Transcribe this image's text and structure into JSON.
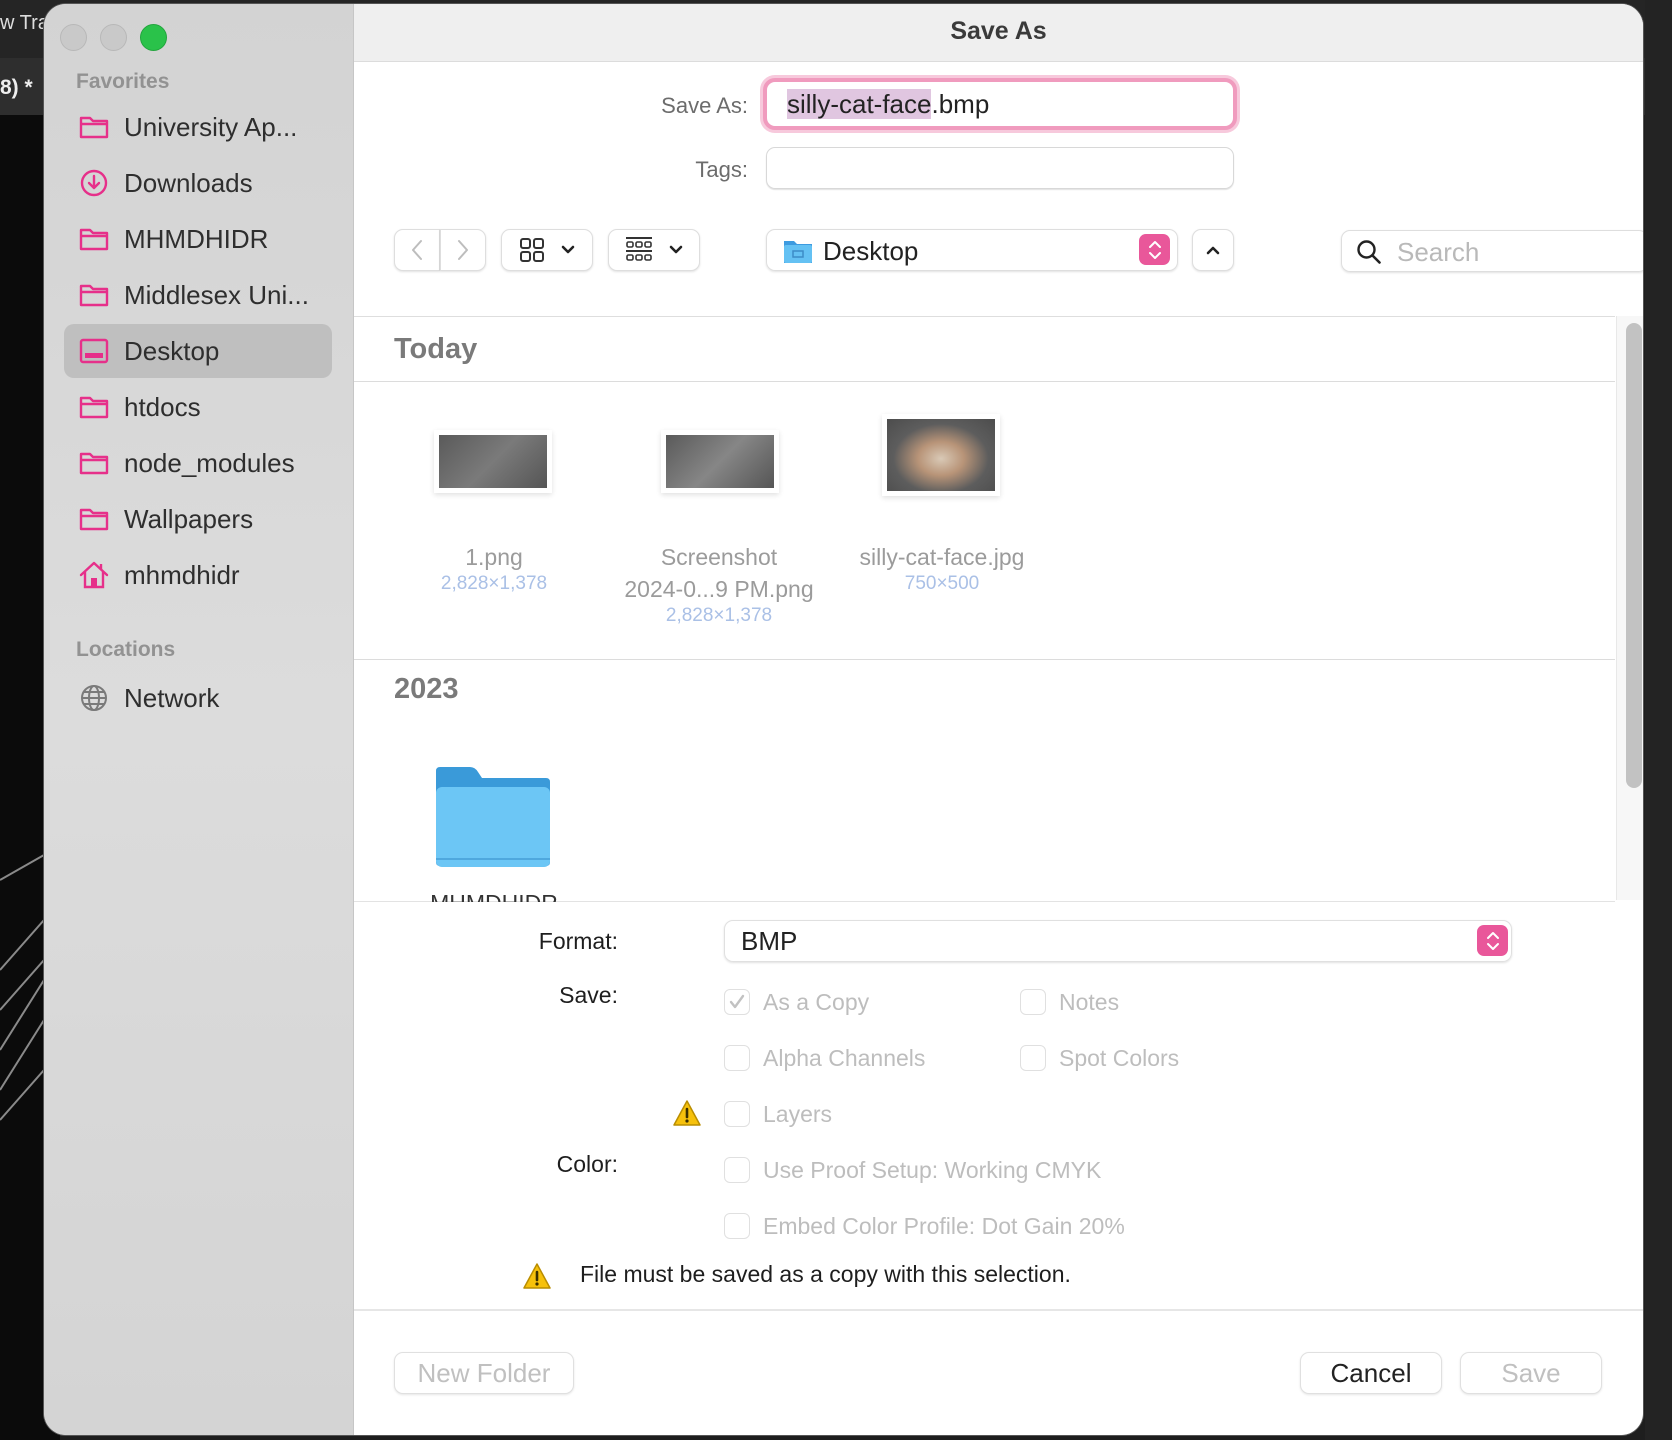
{
  "background": {
    "app_title_fragment": "w Tra",
    "doc_tab_fragment": "8) *"
  },
  "window": {
    "title": "Save As",
    "traffic_lights": [
      "close",
      "minimize",
      "zoom"
    ]
  },
  "sidebar": {
    "favorites_heading": "Favorites",
    "favorites": [
      {
        "label": "University Ap...",
        "icon": "folder-icon",
        "selected": false
      },
      {
        "label": "Downloads",
        "icon": "download-icon",
        "selected": false
      },
      {
        "label": "MHMDHIDR",
        "icon": "folder-icon",
        "selected": false
      },
      {
        "label": "Middlesex Uni...",
        "icon": "folder-icon",
        "selected": false
      },
      {
        "label": "Desktop",
        "icon": "desktop-icon",
        "selected": true
      },
      {
        "label": "htdocs",
        "icon": "folder-icon",
        "selected": false
      },
      {
        "label": "node_modules",
        "icon": "folder-icon",
        "selected": false
      },
      {
        "label": "Wallpapers",
        "icon": "folder-icon",
        "selected": false
      },
      {
        "label": "mhmdhidr",
        "icon": "home-icon",
        "selected": false
      }
    ],
    "locations_heading": "Locations",
    "locations": [
      {
        "label": "Network",
        "icon": "globe-icon"
      }
    ]
  },
  "form": {
    "save_as_label": "Save As:",
    "save_as_value_selected": "silly-cat-face",
    "save_as_value_ext": ".bmp",
    "tags_label": "Tags:",
    "tags_value": ""
  },
  "toolbar": {
    "back": "back-icon",
    "forward": "forward-icon",
    "icon_view": "grid-view-icon",
    "group_view": "gallery-group-icon",
    "location": "Desktop",
    "search_placeholder": "Search"
  },
  "filelist": {
    "sections": [
      {
        "title": "Today",
        "files": [
          {
            "name": "1.png",
            "dimensions": "2,828×1,378"
          },
          {
            "name": "Screenshot 2024-0...9 PM.png",
            "name_line1": "Screenshot",
            "name_line2": "2024-0...9 PM.png",
            "dimensions": "2,828×1,378"
          },
          {
            "name": "silly-cat-face.jpg",
            "dimensions": "750×500"
          }
        ]
      },
      {
        "title": "2023",
        "files": [
          {
            "name": "MHMDHIDR",
            "type": "folder"
          }
        ]
      }
    ]
  },
  "options": {
    "format_label": "Format:",
    "format_value": "BMP",
    "save_label": "Save:",
    "color_label": "Color:",
    "checkboxes": [
      {
        "label": "As a Copy",
        "checked": true,
        "enabled": false
      },
      {
        "label": "Notes",
        "checked": false,
        "enabled": false
      },
      {
        "label": "Alpha Channels",
        "checked": false,
        "enabled": false
      },
      {
        "label": "Spot Colors",
        "checked": false,
        "enabled": false
      },
      {
        "label": "Layers",
        "checked": false,
        "enabled": false,
        "warning": true
      },
      {
        "label": "Use Proof Setup:  Working CMYK",
        "checked": false,
        "enabled": false
      },
      {
        "label": "Embed Color Profile:  Dot Gain 20%",
        "checked": false,
        "enabled": false
      }
    ],
    "warning_message": "File must be saved as a copy with this selection."
  },
  "footer": {
    "new_folder": "New Folder",
    "cancel": "Cancel",
    "save": "Save"
  },
  "colors": {
    "accent": "#e9579a",
    "sidebar_icon": "#e6308a",
    "focus_ring": "#f09bbe",
    "warning": "#f0b400"
  }
}
